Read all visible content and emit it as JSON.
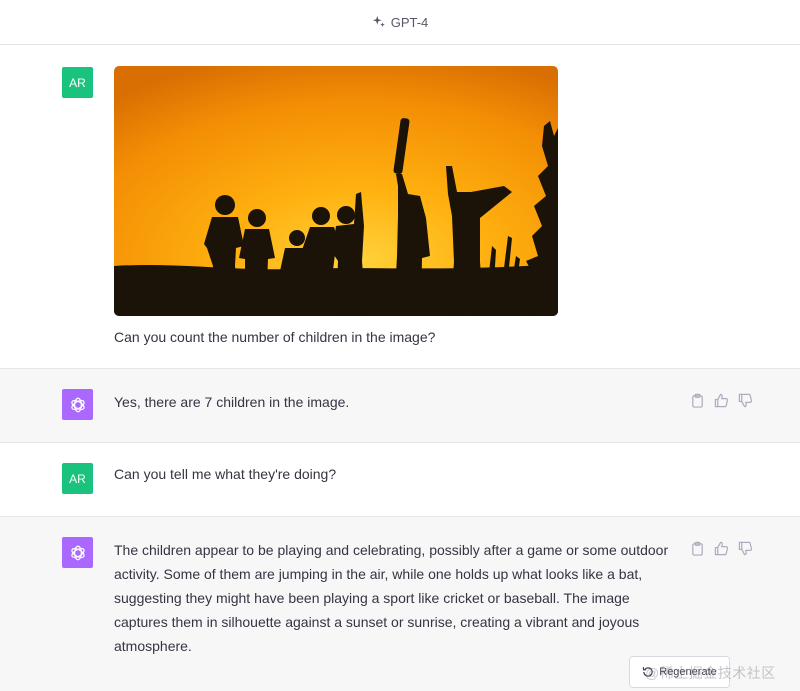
{
  "header": {
    "model_label": "GPT-4",
    "icon": "sparkle-icon"
  },
  "messages": [
    {
      "role": "user",
      "avatar": "AR",
      "image": "children-silhouette-sunset",
      "text": "Can you count the number of children in the image?"
    },
    {
      "role": "assistant",
      "avatar_icon": "openai-logo-icon",
      "text": "Yes, there are 7 children in the image."
    },
    {
      "role": "user",
      "avatar": "AR",
      "text": "Can you tell me what they're doing?"
    },
    {
      "role": "assistant",
      "avatar_icon": "openai-logo-icon",
      "lines": [
        "The children appear to be playing and celebrating, possibly after a game or some outdoor",
        "activity. Some of them are jumping in the air, while one holds up what looks like a bat,",
        "suggesting they might have been playing a sport like cricket or baseball. The image",
        "captures them in silhouette against a sunset or sunrise, creating a vibrant and joyous",
        "atmosphere."
      ]
    }
  ],
  "action_icons": [
    "clipboard-icon",
    "thumbs-up-icon",
    "thumbs-down-icon"
  ],
  "regenerate_label": "Regenerate",
  "watermark": "@稀土掘金技术社区",
  "colors": {
    "user_avatar": "#19c37d",
    "assistant_avatar": "#ab68ff",
    "assistant_bg": "#f7f7f8"
  }
}
